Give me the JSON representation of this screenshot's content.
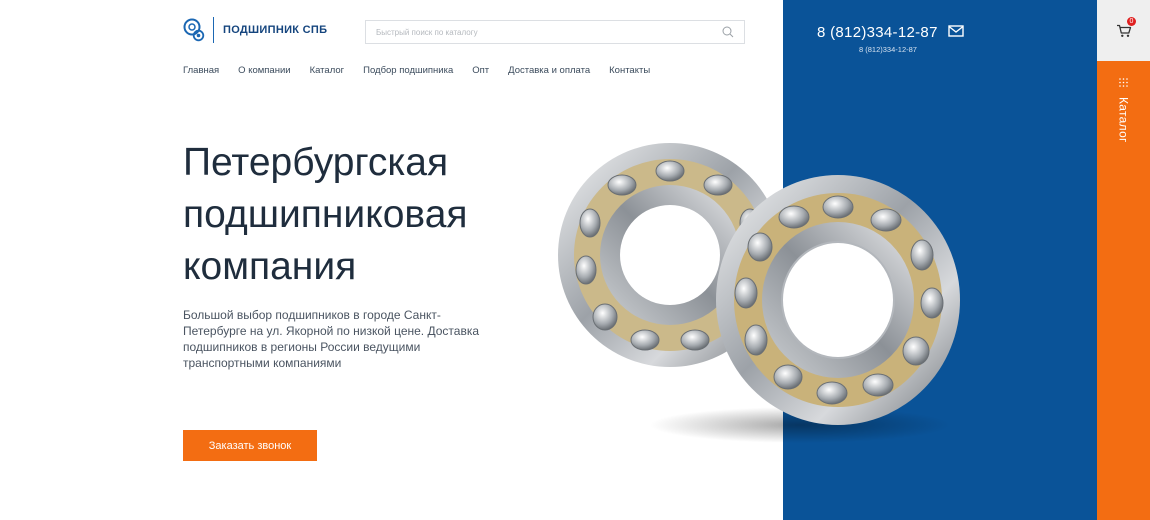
{
  "brand": {
    "name": "ПОДШИПНИК СПБ",
    "logo_icon": "bearing-logo-icon"
  },
  "search": {
    "placeholder": "Быстрый поиск по каталогу"
  },
  "nav": {
    "items": [
      {
        "label": "Главная"
      },
      {
        "label": "О компании"
      },
      {
        "label": "Каталог"
      },
      {
        "label": "Подбор подшипника"
      },
      {
        "label": "Опт"
      },
      {
        "label": "Доставка и оплата"
      },
      {
        "label": "Контакты"
      }
    ]
  },
  "contact": {
    "phone_main": "8 (812)334-12-87",
    "phone_sub": "8 (812)334-12-87"
  },
  "cart": {
    "count": "0"
  },
  "catalog_tab": {
    "label": "Каталог"
  },
  "hero": {
    "title_lines": [
      "Петербургская",
      "подшипниковая",
      "компания"
    ],
    "description": "Большой выбор подшипников в городе Санкт-Петербурге на ул. Якорной по низкой цене. Доставка подшипников в регионы России ведущими транспортными компаниями",
    "cta_label": "Заказать звонок"
  },
  "colors": {
    "accent": "#f36d12",
    "brand_blue": "#0a5398",
    "text_dark": "#1f2d3d"
  }
}
